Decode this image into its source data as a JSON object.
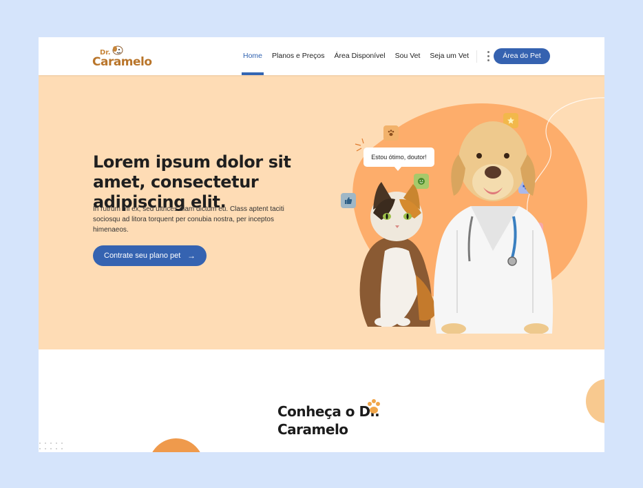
{
  "brand": {
    "prefix": "Dr.",
    "name": "Caramelo"
  },
  "nav": {
    "items": [
      {
        "label": "Home",
        "active": true
      },
      {
        "label": "Planos e Preços",
        "active": false
      },
      {
        "label": "Área Disponível",
        "active": false
      },
      {
        "label": "Sou Vet",
        "active": false
      },
      {
        "label": "Seja um Vet",
        "active": false
      }
    ],
    "account_button": "Área do Pet"
  },
  "hero": {
    "title": "Lorem ipsum dolor sit amet, consectetur adipiscing elit.",
    "description": "In rutrum mi ex, sed ultrices diam dictum eu. Class aptent taciti sociosqu ad litora torquent per conubia nostra, per inceptos himenaeos.",
    "cta_label": "Contrate seu plano pet",
    "speech_bubble": "Estou ótimo, doutor!",
    "badges": [
      {
        "icon": "paw-icon",
        "color": "#f2b26b"
      },
      {
        "icon": "smile-icon",
        "color": "#a7c96a"
      },
      {
        "icon": "thumbs-up-icon",
        "color": "#9fb7c6"
      },
      {
        "icon": "star-icon",
        "color": "#f2b84b"
      },
      {
        "icon": "plus-icon",
        "color": "#a9b8ea"
      },
      {
        "icon": "heart-icon",
        "color": "#f7a7a7"
      }
    ]
  },
  "about": {
    "title_line1": "Conheça o Dr.",
    "title_line2": "Caramelo"
  },
  "colors": {
    "primary": "#3562b0",
    "hero_bg": "#fedcb5",
    "blob": "#fdad6b",
    "background": "#d5e4fb"
  }
}
